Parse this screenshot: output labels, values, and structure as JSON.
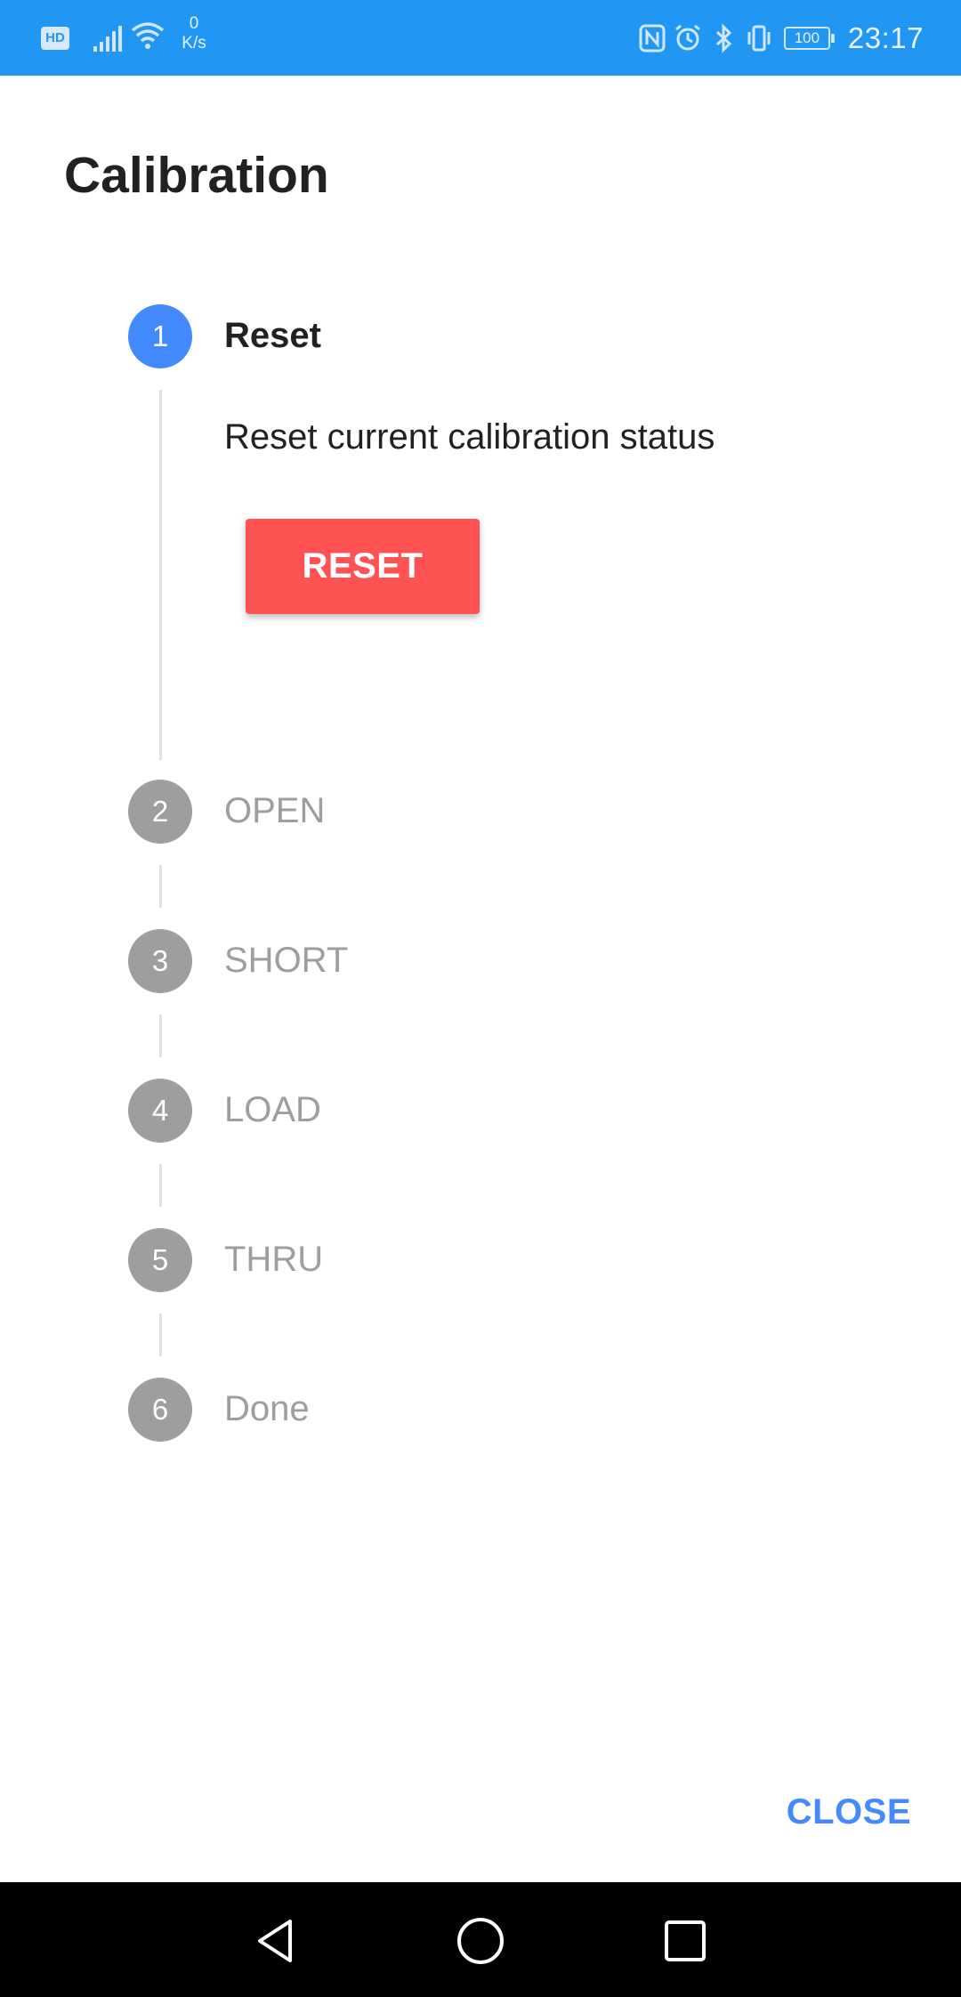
{
  "status_bar": {
    "hd_badge": "HD",
    "speed_value": "0",
    "speed_unit": "K/s",
    "battery": "100",
    "time": "23:17"
  },
  "dialog": {
    "title": "Calibration",
    "steps": [
      {
        "number": "1",
        "label": "Reset",
        "state": "active"
      },
      {
        "number": "2",
        "label": "OPEN",
        "state": "inactive"
      },
      {
        "number": "3",
        "label": "SHORT",
        "state": "inactive"
      },
      {
        "number": "4",
        "label": "LOAD",
        "state": "inactive"
      },
      {
        "number": "5",
        "label": "THRU",
        "state": "inactive"
      },
      {
        "number": "6",
        "label": "Done",
        "state": "inactive"
      }
    ],
    "active_step_description": "Reset current calibration status",
    "reset_button_label": "RESET",
    "close_button_label": "CLOSE"
  },
  "colors": {
    "status_bar": "#2196F3",
    "active_step": "#448AFF",
    "inactive_step": "#9E9E9E",
    "reset_button": "#FF5252",
    "close_button": "#448AFF"
  }
}
